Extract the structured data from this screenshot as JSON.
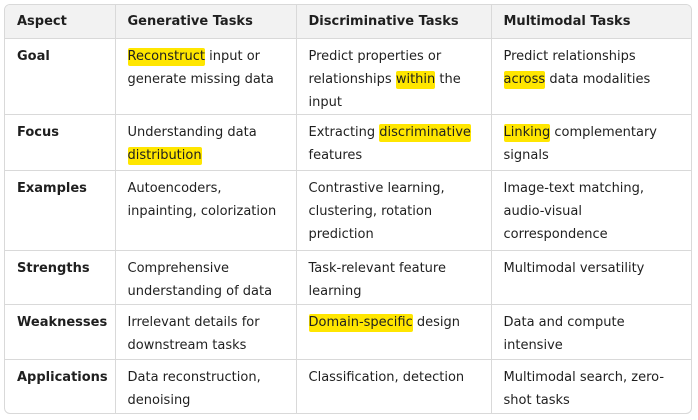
{
  "table": {
    "headers": [
      "Aspect",
      "Generative Tasks",
      "Discriminative Tasks",
      "Multimodal Tasks"
    ],
    "rows": [
      {
        "aspect": "Goal",
        "gen": {
          "hl": "Reconstruct",
          "rest": " input or generate missing data"
        },
        "disc": {
          "pre": "Predict properties or relationships ",
          "hl": "within",
          "post": " the input"
        },
        "multi": {
          "pre": "Predict relationships ",
          "hl": "across",
          "post": " data modalities"
        }
      },
      {
        "aspect": "Focus",
        "gen": {
          "pre": "Understanding data ",
          "hl": "distribution"
        },
        "disc": {
          "pre": "Extracting ",
          "hl": "discriminative",
          "post": " features"
        },
        "multi": {
          "hl": "Linking",
          "rest": " complementary signals"
        }
      },
      {
        "aspect": "Examples",
        "gen": "Autoencoders, inpainting, colorization",
        "disc": "Contrastive learning, clustering, rotation prediction",
        "multi": "Image-text matching, audio-visual correspondence"
      },
      {
        "aspect": "Strengths",
        "gen": "Comprehensive understanding of data",
        "disc": "Task-relevant feature learning",
        "multi": "Multimodal versatility"
      },
      {
        "aspect": "Weaknesses",
        "gen": "Irrelevant details for downstream tasks",
        "disc": {
          "hl": "Domain-specific",
          "rest": " design"
        },
        "multi": "Data and compute intensive"
      },
      {
        "aspect": "Applications",
        "gen": "Data reconstruction, denoising",
        "disc": "Classification, detection",
        "multi": "Multimodal search, zero-shot tasks"
      }
    ]
  },
  "colors": {
    "highlight": "#ffe600",
    "header_bg": "#f2f2f2",
    "border": "#d9d9d9"
  }
}
